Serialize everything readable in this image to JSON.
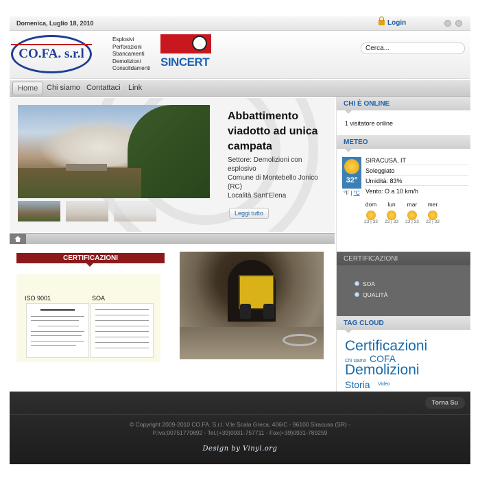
{
  "topbar": {
    "date": "Domenica, Luglio 18, 2010",
    "login_label": "Login"
  },
  "header": {
    "logo_text": "CO.FA. s.r.l",
    "services": [
      "Esplosivi",
      "Perforazioni",
      "Sbancamenti",
      "Demolizioni",
      "Consolidamenti"
    ],
    "cert_logo_text": "SINCERT",
    "search_value": "Cerca..."
  },
  "nav": {
    "items": [
      {
        "label": "Home",
        "active": true
      },
      {
        "label": "Chi siamo"
      },
      {
        "label": "Contattaci"
      },
      {
        "label": "Link"
      }
    ]
  },
  "slider": {
    "title": "Abbattimento viadotto ad unica campata",
    "desc_lines": [
      "Settore: Demolizioni con esplosivo",
      "Comune di Montebello Jonico (RC)",
      "Località Sant'Elena"
    ],
    "read_more": "Leggi tutto"
  },
  "certificazioni_box": {
    "heading": "CERTIFICAZIONI",
    "label_iso": "ISO 9001",
    "label_soa": "SOA"
  },
  "sidebar": {
    "online": {
      "heading": "CHI È ONLINE",
      "text": "1 visitatore online"
    },
    "meteo": {
      "heading": "METEO",
      "location": "SIRACUSA, IT",
      "condition": "Soleggiato",
      "temperature": "32°",
      "humidity": "Umidità: 83%",
      "wind": "Vento: O a 10 km/h",
      "unit_f": "°F",
      "unit_c": "°C",
      "forecast": [
        {
          "day": "dom",
          "temps": "23 | 33"
        },
        {
          "day": "lun",
          "temps": "23 | 33"
        },
        {
          "day": "mar",
          "temps": "23 | 33"
        },
        {
          "day": "mer",
          "temps": "22 | 33"
        }
      ]
    },
    "certificazioni": {
      "heading": "CERTIFICAZIONI",
      "items": [
        "SOA",
        "QUALITÀ"
      ]
    },
    "tagcloud": {
      "heading": "TAG CLOUD",
      "tags": [
        "Certificazioni",
        "Chi siamo",
        "COFA",
        "Demolizioni",
        "Storia",
        "Video"
      ]
    }
  },
  "footer": {
    "to_top": "Torna Su",
    "copyright_line1": "© Copyright 2009-2010 CO.FA. S.r.l. V.le Scala Greca, 406/C - 96100 Siracusa (SR) -",
    "copyright_line2": "P.Iva:00751770892 - Tel.(+39)0931-757711 - Fax(+39)0931-789259",
    "design_credit": "Design by Vinyl.org"
  }
}
